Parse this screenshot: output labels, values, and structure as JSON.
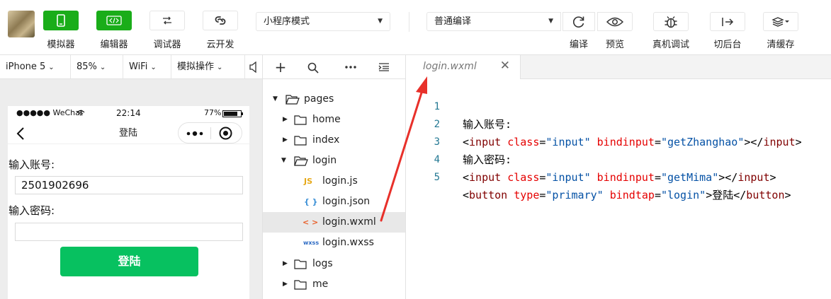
{
  "toolbar": {
    "buttons": [
      {
        "label": "模拟器",
        "icon": "phone-icon"
      },
      {
        "label": "编辑器",
        "icon": "code-icon"
      },
      {
        "label": "调试器",
        "icon": "debug-switch-icon"
      },
      {
        "label": "云开发",
        "icon": "cloud-link-icon"
      }
    ],
    "mode_select": "小程序模式",
    "compile_select": "普通编译",
    "right_buttons": [
      {
        "label": "编译",
        "icon": "refresh-icon"
      },
      {
        "label": "预览",
        "icon": "eye-icon"
      },
      {
        "label": "真机调试",
        "icon": "bug-icon"
      },
      {
        "label": "切后台",
        "icon": "switch-background-icon"
      },
      {
        "label": "清缓存",
        "icon": "layers-icon"
      }
    ]
  },
  "device_bar": {
    "device": "iPhone 5",
    "zoom": "85%",
    "network": "WiFi",
    "operation": "模拟操作"
  },
  "simulator": {
    "status_carrier": "●●●●● WeChat",
    "status_time": "22:14",
    "status_battery": "77%",
    "nav_title": "登陆",
    "account_label": "输入账号:",
    "account_value": "2501902696",
    "password_label": "输入密码:",
    "password_value": "",
    "login_button": "登陆"
  },
  "file_tree": {
    "root": "pages",
    "items": [
      {
        "name": "home",
        "type": "folder"
      },
      {
        "name": "index",
        "type": "folder"
      },
      {
        "name": "login",
        "type": "folder-open"
      },
      {
        "name": "login.js",
        "type": "js",
        "badge": "JS"
      },
      {
        "name": "login.json",
        "type": "json",
        "badge": "{ }"
      },
      {
        "name": "login.wxml",
        "type": "wxml",
        "badge": "< >"
      },
      {
        "name": "login.wxss",
        "type": "wxss",
        "badge": "wxss"
      },
      {
        "name": "logs",
        "type": "folder"
      },
      {
        "name": "me",
        "type": "folder"
      }
    ]
  },
  "editor": {
    "tab_title": "login.wxml",
    "lines": [
      {
        "n": "1",
        "text": "输入账号:"
      },
      {
        "n": "2",
        "tag": "input",
        "a1": "class",
        "v1": "\"input\"",
        "a2": "bindinput",
        "v2": "\"getZhanghao\"",
        "close": "input"
      },
      {
        "n": "3",
        "text": "输入密码:"
      },
      {
        "n": "4",
        "tag": "input",
        "a1": "class",
        "v1": "\"input\"",
        "a2": "bindinput",
        "v2": "\"getMima\"",
        "close": "input"
      },
      {
        "n": "5",
        "tag": "button",
        "a1": "type",
        "v1": "\"primary\"",
        "a2": "bindtap",
        "v2": "\"login\"",
        "inner": "登陆",
        "close": "button"
      }
    ]
  },
  "colors": {
    "green": "#1aad19",
    "wechat_green": "#07c160",
    "arrow_red": "#e8302a"
  }
}
